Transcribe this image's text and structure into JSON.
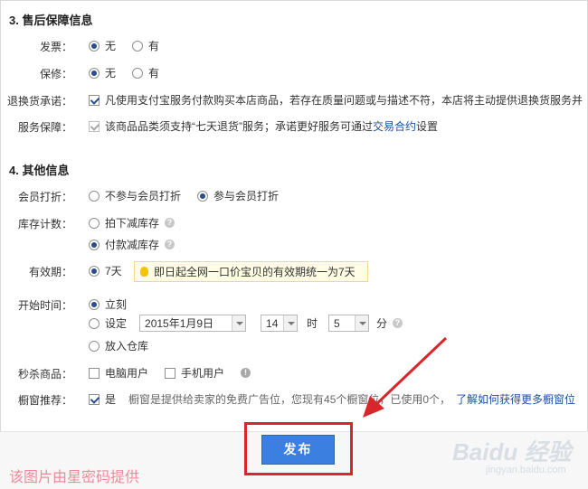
{
  "section3": {
    "title": "3. 售后保障信息",
    "invoice": {
      "label": "发票：",
      "opt_none": "无",
      "opt_yes": "有"
    },
    "warranty": {
      "label": "保修：",
      "opt_none": "无",
      "opt_yes": "有"
    },
    "return_promise": {
      "label": "退换货承诺：",
      "text": "凡使用支付宝服务付款购买本店商品，若存在质量问题或与描述不符，本店将主动提供退换货服务并"
    },
    "service": {
      "label": "服务保障：",
      "text_prefix": "该商品品类须支持“七天退货”服务；承诺更好服务可通过",
      "link": "交易合约",
      "text_suffix": "设置"
    }
  },
  "section4": {
    "title": "4. 其他信息",
    "member_discount": {
      "label": "会员打折：",
      "opt_no": "不参与会员打折",
      "opt_yes": "参与会员打折"
    },
    "stock": {
      "label": "库存计数：",
      "opt_order": "拍下减库存",
      "opt_pay": "付款减库存"
    },
    "validity": {
      "label": "有效期：",
      "value": "7天",
      "tip": "即日起全网一口价宝贝的有效期统一为7天"
    },
    "start_time": {
      "label": "开始时间：",
      "opt_now": "立刻",
      "opt_set": "设定",
      "date": "2015年1月9日",
      "hour": "14",
      "hour_unit": "时",
      "minute": "5",
      "minute_unit": "分",
      "opt_warehouse": "放入仓库"
    },
    "flash_sale": {
      "label": "秒杀商品：",
      "opt_pc": "电脑用户",
      "opt_mobile": "手机用户"
    },
    "showcase": {
      "label": "橱窗推荐：",
      "opt_yes": "是",
      "desc": "橱窗是提供给卖家的免费广告位，您现有45个橱窗位，已使用0个，",
      "link": "了解如何获得更多橱窗位"
    }
  },
  "footer": {
    "publish_label": "发布",
    "watermark": "该图片由星密码提供",
    "baidu_text": "Baidu 经验",
    "baidu_sub": "jingyan.baidu.com"
  },
  "colors": {
    "accent": "#3b7fe0",
    "highlight_box": "#d8262a",
    "link": "#1e4fa1"
  }
}
